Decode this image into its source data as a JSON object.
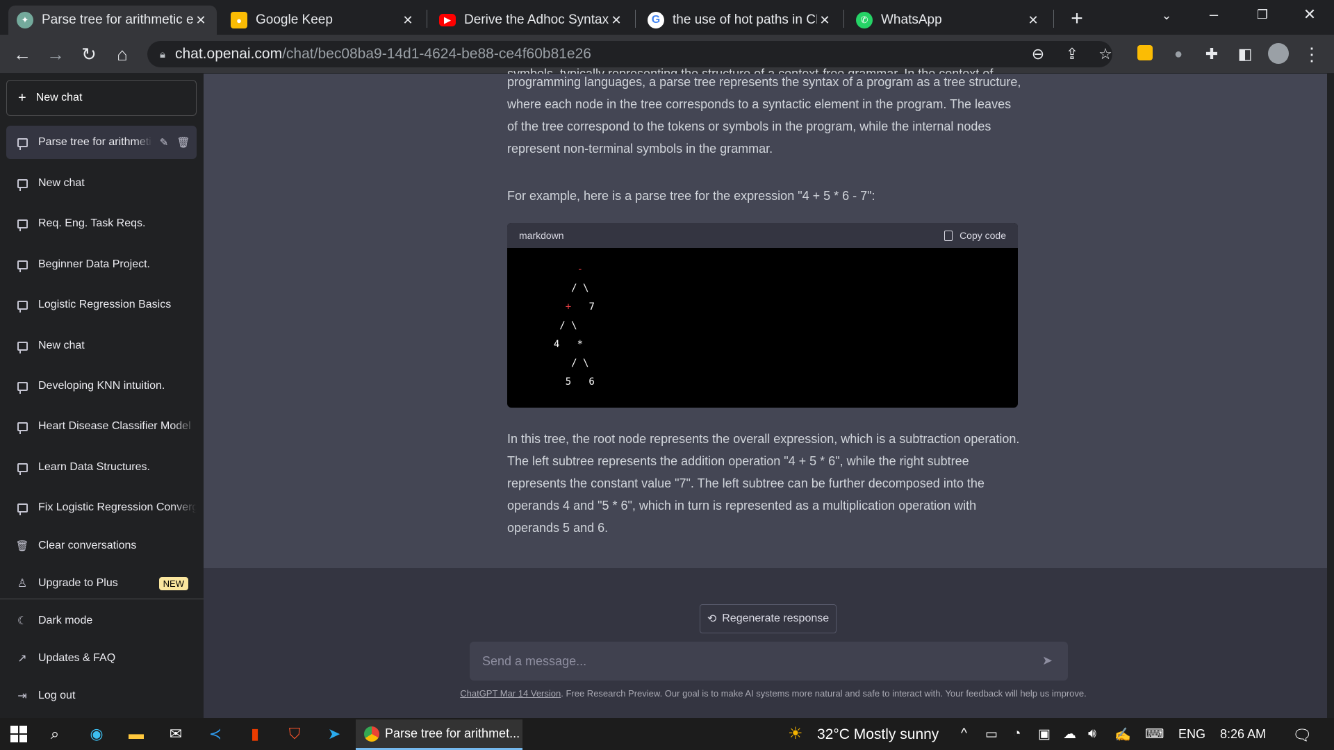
{
  "browser": {
    "tabs": [
      {
        "title": "Parse tree for arithmetic e",
        "icon": "openai-icon"
      },
      {
        "title": "Google Keep",
        "icon": "keep-icon"
      },
      {
        "title": "Derive the Adhoc Syntax D",
        "icon": "youtube-icon"
      },
      {
        "title": "the use of hot paths in CF",
        "icon": "google-icon"
      },
      {
        "title": "WhatsApp",
        "icon": "whatsapp-icon"
      }
    ],
    "url_host": "chat.openai.com",
    "url_path": "/chat/bec08ba9-14d1-4624-be88-ce4f60b81e26"
  },
  "sidebar": {
    "new_chat": "New chat",
    "conversations": [
      {
        "label": "Parse tree for arithmetic expression"
      },
      {
        "label": "New chat"
      },
      {
        "label": "Req. Eng. Task Reqs."
      },
      {
        "label": "Beginner Data Project."
      },
      {
        "label": "Logistic Regression Basics"
      },
      {
        "label": "New chat"
      },
      {
        "label": "Developing KNN intuition."
      },
      {
        "label": "Heart Disease Classifier Model"
      },
      {
        "label": "Learn Data Structures."
      },
      {
        "label": "Fix Logistic Regression Convergence"
      }
    ],
    "clear": "Clear conversations",
    "upgrade": "Upgrade to Plus",
    "upgrade_badge": "NEW",
    "dark_mode": "Dark mode",
    "updates": "Updates & FAQ",
    "logout": "Log out"
  },
  "message": {
    "intro_clipped": "symbols, typically representing the structure of a context-free grammar. In the context of",
    "para1": "programming languages, a parse tree represents the syntax of a program as a tree structure, where each node in the tree corresponds to a syntactic element in the program. The leaves of the tree correspond to the tokens or symbols in the program, while the internal nodes represent non-terminal symbols in the grammar.",
    "para2": "For example, here is a parse tree for the expression \"4 + 5 * 6 - 7\":",
    "code_lang": "markdown",
    "copy_code": "Copy code",
    "code_lines": [
      "      -",
      "     / \\",
      "    +   7",
      "   / \\",
      "  4   *",
      "     / \\",
      "    5   6"
    ],
    "para3": "In this tree, the root node represents the overall expression, which is a subtraction operation. The left subtree represents the addition operation \"4 + 5 * 6\", while the right subtree represents the constant value \"7\". The left subtree can be further decomposed into the operands 4 and \"5 * 6\", which in turn is represented as a multiplication operation with operands 5 and 6."
  },
  "composer": {
    "regenerate": "Regenerate response",
    "placeholder": "Send a message...",
    "footer_link": "ChatGPT Mar 14 Version",
    "footer_text": ". Free Research Preview. Our goal is to make AI systems more natural and safe to interact with. Your feedback will help us improve."
  },
  "taskbar": {
    "active_app": "Parse tree for arithmet...",
    "weather": "32°C  Mostly sunny",
    "lang": "ENG",
    "time": "8:26 AM"
  },
  "colors": {
    "accent_badge": "#fae69e",
    "tree_operator": "#ef4146"
  }
}
